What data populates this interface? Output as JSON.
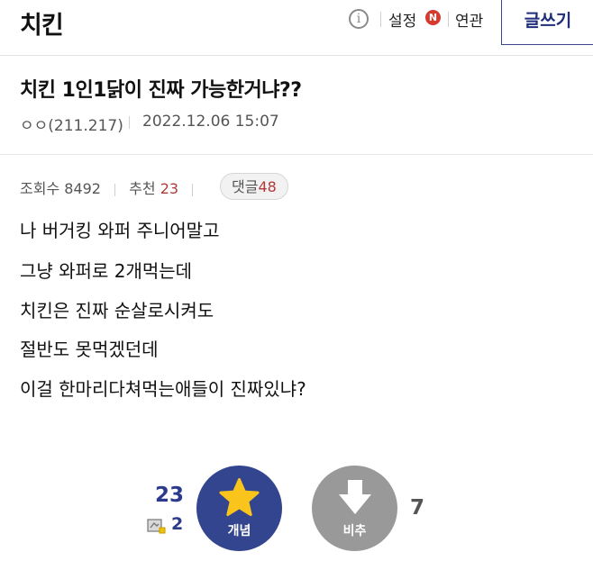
{
  "header": {
    "gallery_title": "치킨",
    "info_icon": "i",
    "setting_label": "설정",
    "new_badge": "N",
    "related_label": "연관",
    "write_button": "글쓰기"
  },
  "post": {
    "title": "치킨 1인1닭이 진짜 가능한거냐??",
    "author": "ㅇㅇ(211.217)",
    "date": "2022.12.06 15:07",
    "views_label": "조회수",
    "views": "8492",
    "recommend_label": "추천",
    "recommend": "23",
    "comments_label": "댓글",
    "comments": "48",
    "body_lines": [
      "나 버거킹 와퍼 주니어말고",
      "그냥 와퍼로 2개먹는데",
      "치킨은 진짜 순살로시켜도",
      "절반도 못먹겠던데",
      "이걸 한마리다쳐먹는애들이 진짜있냐?"
    ]
  },
  "vote": {
    "up_count": "23",
    "fixed_count": "2",
    "up_label": "개념",
    "down_label": "비추",
    "down_count": "7"
  },
  "icons": [
    "info-icon",
    "star-icon",
    "down-arrow-icon",
    "fixed-user-icon"
  ],
  "colors": {
    "accent": "#34458f",
    "down_button": "#999999",
    "badge": "#d6392e",
    "recommend_number": "#b03a3a"
  }
}
